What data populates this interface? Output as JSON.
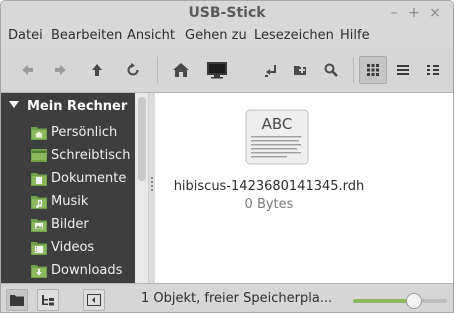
{
  "window": {
    "title": "USB-Stick"
  },
  "window_controls": {
    "minimize": "–",
    "maximize": "+",
    "close": "×"
  },
  "menu": [
    "Datei",
    "Bearbeiten",
    "Ansicht",
    "Gehen zu",
    "Lesezeichen",
    "Hilfe"
  ],
  "sidebar": {
    "header": "Mein Rechner",
    "items": [
      {
        "label": "Persönlich",
        "icon": "home-folder-icon"
      },
      {
        "label": "Schreibtisch",
        "icon": "desktop-folder-icon"
      },
      {
        "label": "Dokumente",
        "icon": "documents-folder-icon"
      },
      {
        "label": "Musik",
        "icon": "music-folder-icon"
      },
      {
        "label": "Bilder",
        "icon": "pictures-folder-icon"
      },
      {
        "label": "Videos",
        "icon": "videos-folder-icon"
      },
      {
        "label": "Downloads",
        "icon": "downloads-folder-icon"
      }
    ]
  },
  "files": [
    {
      "name": "hibiscus-1423680141345.rdh",
      "size": "0 Bytes",
      "icon_text": "ABC"
    }
  ],
  "statusbar": {
    "text": "1 Objekt, freier Speicherpla...",
    "zoom_level": 0.65
  },
  "colors": {
    "sidebar_bg": "#3e3e3e",
    "folder_green": "#8cb85e",
    "zoom_fill": "#8cb85e"
  }
}
